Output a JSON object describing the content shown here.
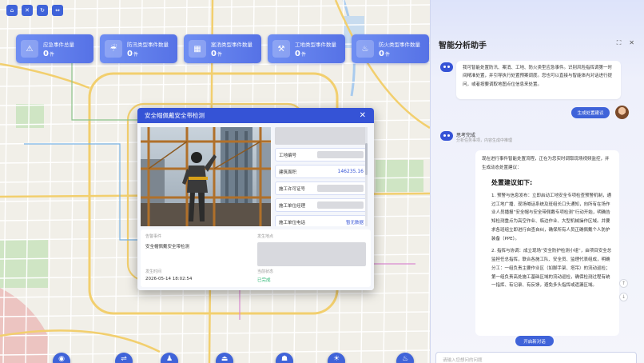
{
  "window_buttons": [
    {
      "icon": "house-icon",
      "glyph": "⌂"
    },
    {
      "icon": "cross-icon",
      "glyph": "✕"
    },
    {
      "icon": "refresh-icon",
      "glyph": "↻"
    },
    {
      "icon": "fullscreen-icon",
      "glyph": "⇔"
    }
  ],
  "stats": [
    {
      "label": "应急事件总量",
      "value": "0",
      "unit": "件",
      "icon": "warning-icon",
      "glyph": "⚠"
    },
    {
      "label": "防汛类型事件数量",
      "value": "0",
      "unit": "件",
      "icon": "flood-icon",
      "glyph": "☔"
    },
    {
      "label": "案消类型事件数量",
      "value": "0",
      "unit": "件",
      "icon": "building-icon",
      "glyph": "▦"
    },
    {
      "label": "工地类型事件数量",
      "value": "0",
      "unit": "件",
      "icon": "worker-icon",
      "glyph": "⚒"
    },
    {
      "label": "防火类型事件数量",
      "value": "0",
      "unit": "件",
      "icon": "fire-icon",
      "glyph": "♨"
    }
  ],
  "modal": {
    "title": "安全帽佩戴安全带检测",
    "fields": [
      {
        "label": "工地编号",
        "value": ""
      },
      {
        "label": "建筑面积",
        "value": "146235.16"
      },
      {
        "label": "施工许可证号",
        "value": ""
      },
      {
        "label": "施工单位经理",
        "value": ""
      },
      {
        "label": "施工单位电话",
        "value": "",
        "link": "暂无数据"
      }
    ],
    "details": {
      "event_label": "告警事件",
      "event_value": "安全帽佩戴安全带检测",
      "location_label": "发生地点",
      "time_label": "发生时间",
      "time_value": "2026-05-14 18:02:54",
      "status_label": "当前状态",
      "status_value": "已完成"
    }
  },
  "bottom_icons": [
    "camera-icon",
    "route-icon",
    "person-icon",
    "alarm-icon",
    "helmet-icon",
    "sun-icon",
    "lamp-icon"
  ],
  "assistant": {
    "title": "智能分析助手",
    "bot_intro": "我可智能处置防汛、案消、工地、防火类型应急事件。识别风险指挥调第一时间精准处置，并引导执行处置预案调度。您也可以直接与智能体内对话进行提问，或者按要调取地图点位信息来处置。",
    "generate_button": "生成处置建议",
    "thinking_title": "思考完成",
    "thinking_sub": "分析任务事项，内容生成中推理",
    "answer_intro": "现在进行事件智能处置流程，正在为您实时调取现场视频监控，并生成动态处置建议：",
    "answer_heading": "处置建议如下:",
    "answer_items": [
      "1. **预警与信息发布**：立即启动工地安全专项检查预警机制，通过工地广播、现场喊话系统及班组长口头通知，向所有在场作业人员播报“安全帽与安全带佩戴专项检测”行动开始，明确告知检测重点为高空作业、临边作业、大型机械操作区域。并要求各班组立即进行自查自纠，确保所有人员正确佩戴个人防护装备（PPE）。",
      "2. **指挥与协调**：成立现场“安全防护检测小组”，由项目安全总监担任总指挥，联合各施工队、安全员、监理代表组成，明确分工：一组负责主要作业区（如脚手架、塔吊）的流动巡检；第一组负责高处施工基础区域的流动巡检，确保检测过程有统一指挥、有记录、有反馈，避免多头指挥或遗漏区域。"
    ],
    "new_chat_button": "开启新对话",
    "input_placeholder": "请输入您想问的问题"
  }
}
